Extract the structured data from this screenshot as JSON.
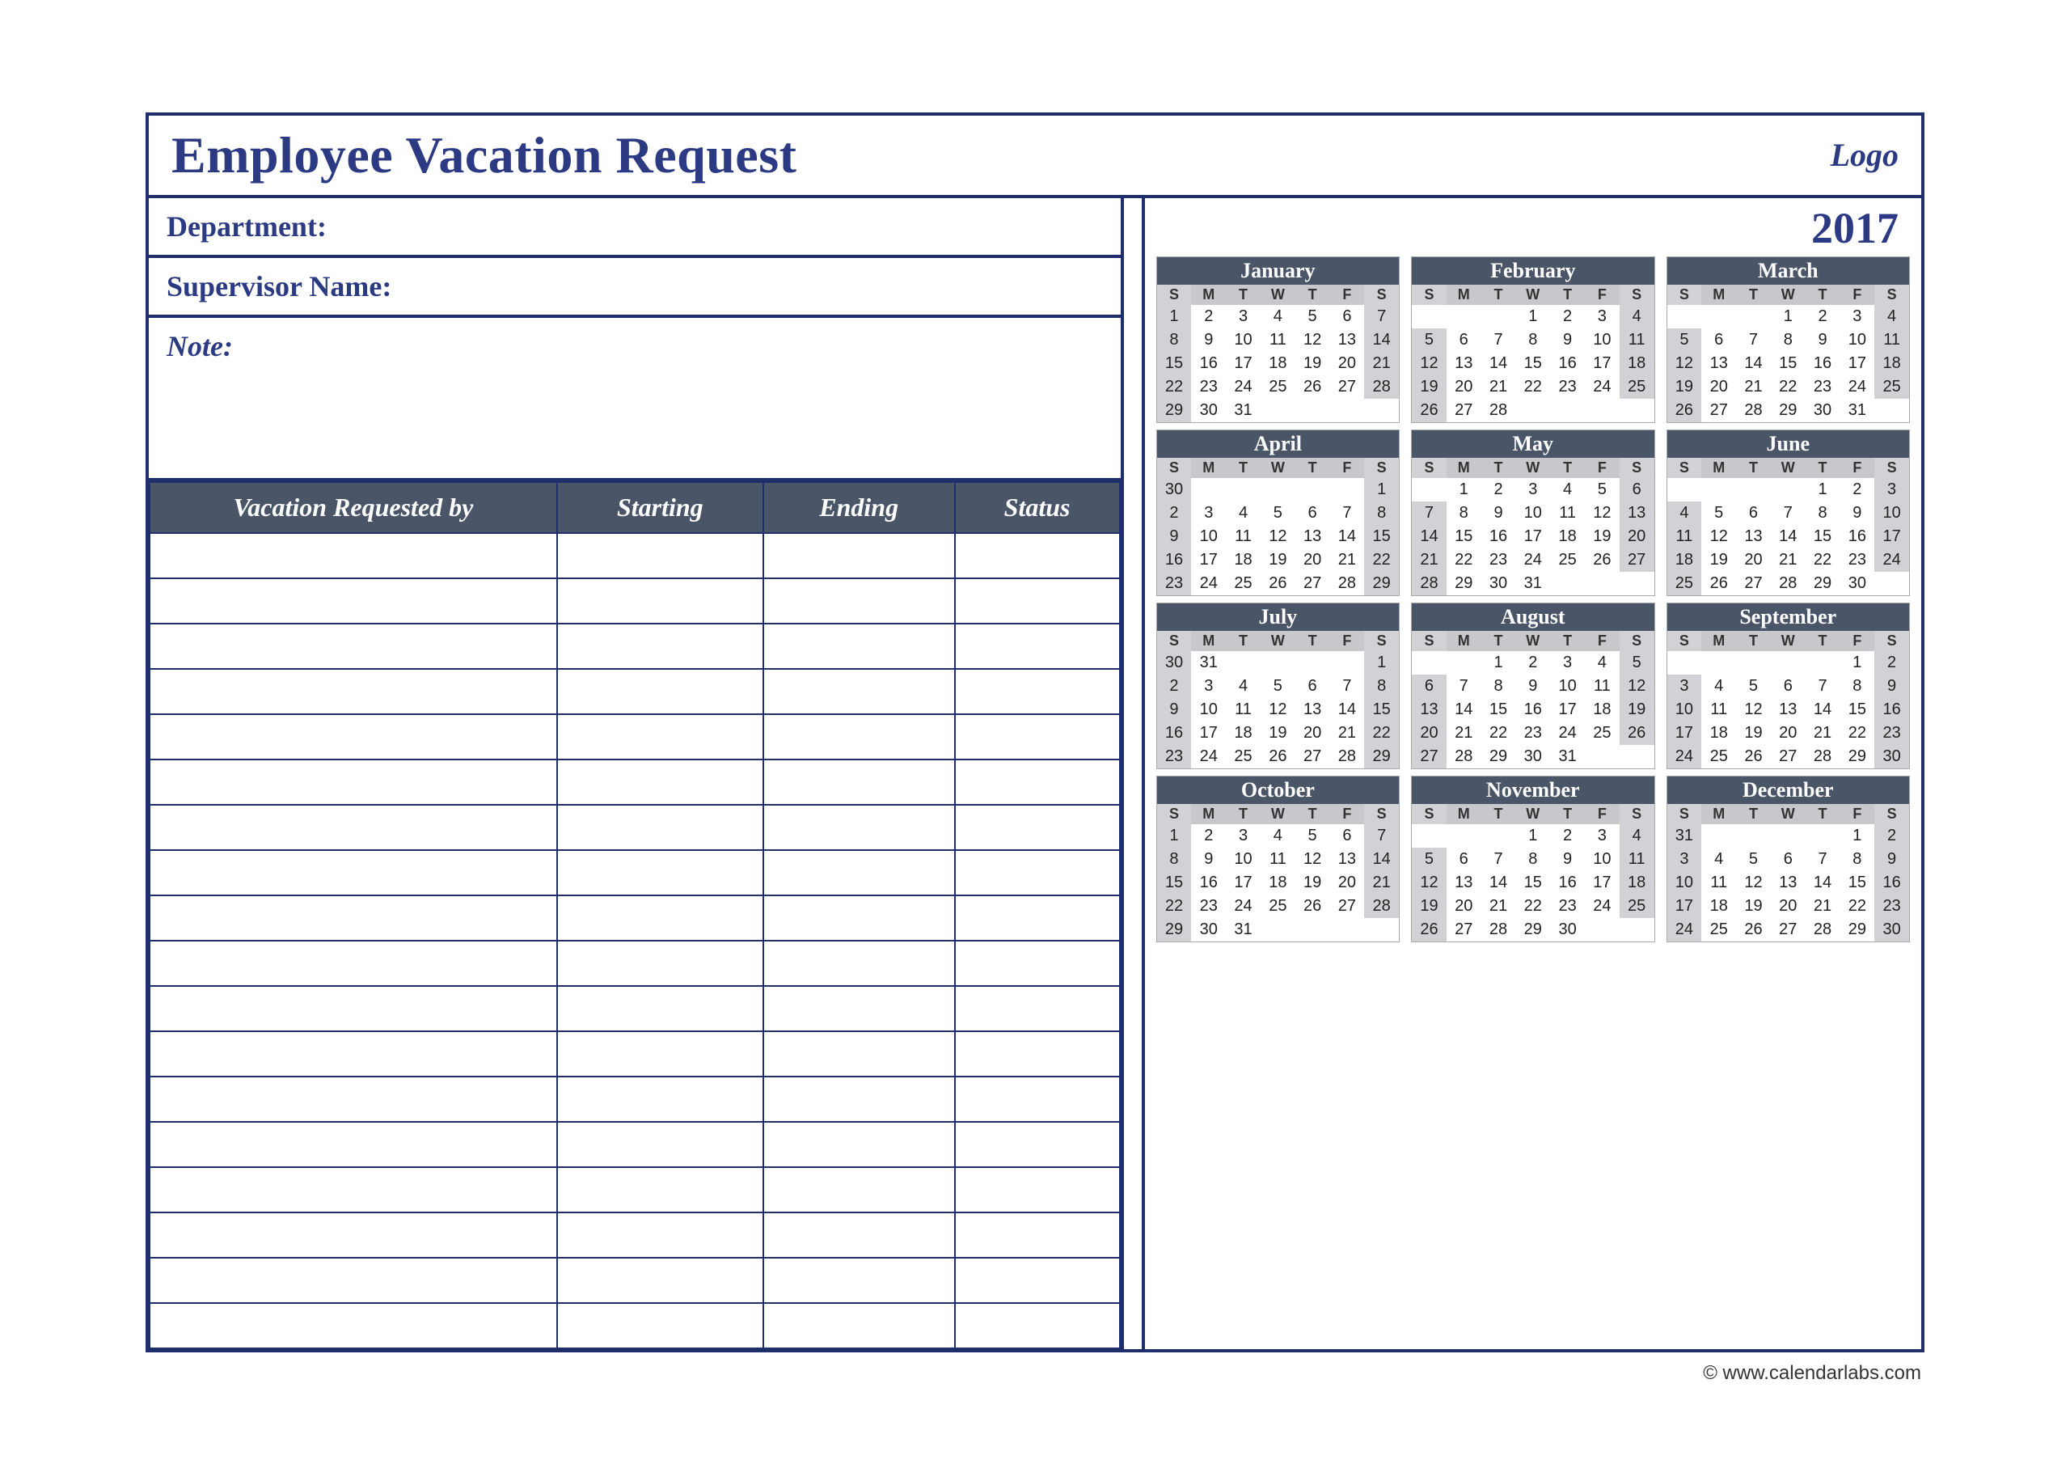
{
  "header": {
    "title": "Employee Vacation Request",
    "logo": "Logo"
  },
  "fields": {
    "department": "Department:",
    "supervisor": "Supervisor Name:",
    "note": "Note:"
  },
  "request_table": {
    "columns": [
      "Vacation Requested by",
      "Starting",
      "Ending",
      "Status"
    ],
    "empty_rows": 18
  },
  "calendar": {
    "year": "2017",
    "day_headers": [
      "S",
      "M",
      "T",
      "W",
      "T",
      "F",
      "S"
    ],
    "months": [
      {
        "name": "January",
        "lead": 0,
        "days": 31,
        "prev": []
      },
      {
        "name": "February",
        "lead": 3,
        "days": 28,
        "prev": []
      },
      {
        "name": "March",
        "lead": 3,
        "days": 31,
        "prev": []
      },
      {
        "name": "April",
        "lead": 6,
        "days": 29,
        "prev": [
          30
        ]
      },
      {
        "name": "May",
        "lead": 1,
        "days": 31,
        "prev": []
      },
      {
        "name": "June",
        "lead": 4,
        "days": 30,
        "prev": []
      },
      {
        "name": "July",
        "lead": 6,
        "days": 29,
        "prev": [
          30,
          31
        ]
      },
      {
        "name": "August",
        "lead": 2,
        "days": 31,
        "prev": []
      },
      {
        "name": "September",
        "lead": 5,
        "days": 30,
        "prev": []
      },
      {
        "name": "October",
        "lead": 0,
        "days": 31,
        "prev": []
      },
      {
        "name": "November",
        "lead": 3,
        "days": 30,
        "prev": []
      },
      {
        "name": "December",
        "lead": 5,
        "days": 30,
        "prev": [
          31
        ]
      }
    ]
  },
  "credit": "© www.calendarlabs.com"
}
